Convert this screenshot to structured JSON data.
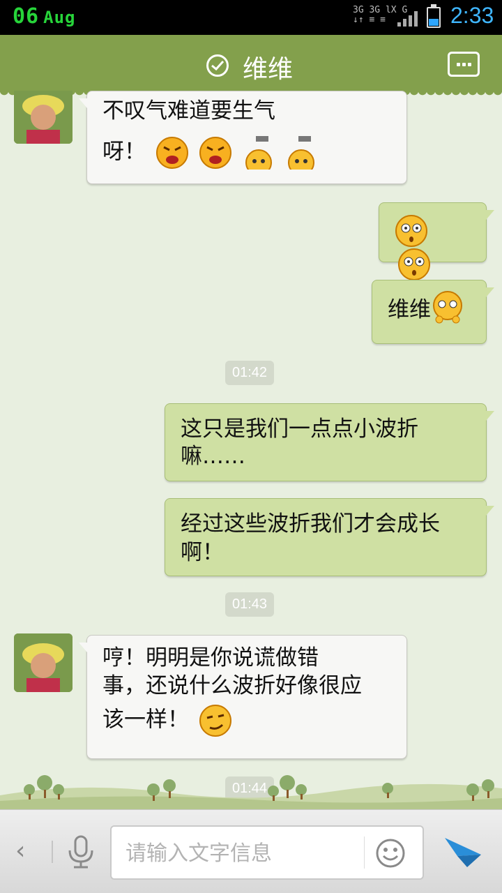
{
  "status_bar": {
    "day": "06",
    "month": "Aug",
    "network_top": "3G 3G lX G",
    "time": "2:33"
  },
  "header": {
    "title": "维维"
  },
  "messages": [
    {
      "side": "in",
      "lines": [
        "不叹气难道要生气",
        "呀！"
      ],
      "emojis": [
        "angry-face-icon",
        "angry-face-icon",
        "hammer-face-icon",
        "hammer-face-icon"
      ]
    },
    {
      "side": "out",
      "lines": [
        ""
      ],
      "emojis": [
        "shocked-face-icon",
        "shocked-face-icon"
      ]
    },
    {
      "side": "out",
      "lines": [
        "维维"
      ],
      "emojis": [
        "pleading-face-icon"
      ]
    },
    {
      "side": "time",
      "text": "01:42"
    },
    {
      "side": "out",
      "lines": [
        "这只是我们一点点小波折",
        "嘛……"
      ]
    },
    {
      "side": "out",
      "lines": [
        "经过这些波折我们才会成长",
        "啊！"
      ]
    },
    {
      "side": "time",
      "text": "01:43"
    },
    {
      "side": "in",
      "lines": [
        "哼！明明是你说谎做错",
        "事，还说什么波折好像很应",
        "该一样！"
      ],
      "emojis": [
        "smirk-face-icon"
      ]
    },
    {
      "side": "time",
      "text": "01:44"
    }
  ],
  "input": {
    "placeholder": "请输入文字信息"
  },
  "colors": {
    "header": "#83a04c",
    "bubble_out": "#cfe0a3",
    "bubble_in": "#f7f7f5",
    "accent": "#3fb6ff"
  }
}
